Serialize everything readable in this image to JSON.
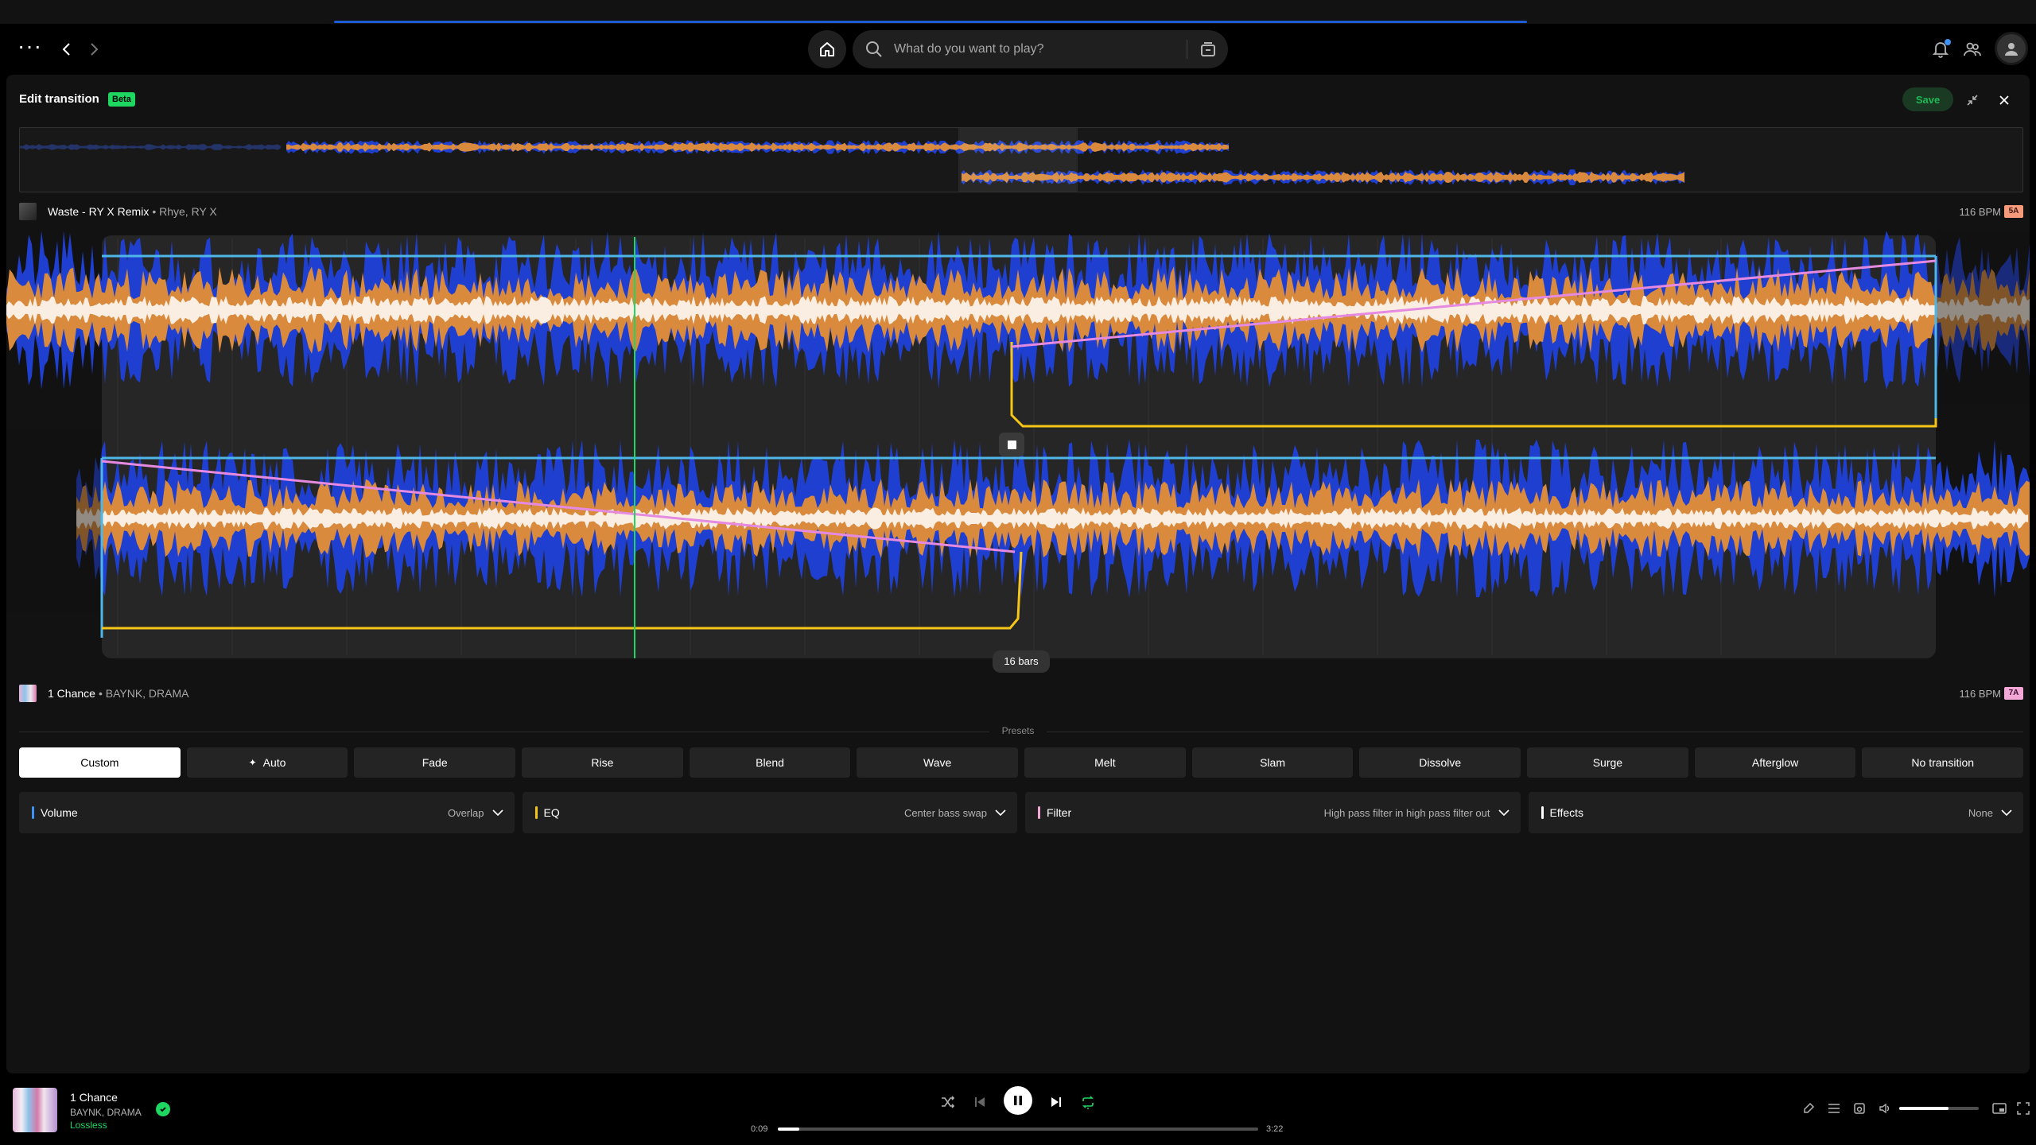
{
  "search": {
    "placeholder": "What do you want to play?"
  },
  "editor": {
    "title": "Edit transition",
    "badge": "Beta",
    "save_label": "Save",
    "bars_label": "16 bars",
    "presets_label": "Presets"
  },
  "track_a": {
    "name": "Waste - RY X Remix",
    "artist": "• Rhye, RY X",
    "bpm": "116 BPM",
    "key": "5A",
    "key_color": "#f59b7c"
  },
  "track_b": {
    "name": "1 Chance",
    "artist": "• BAYNK, DRAMA",
    "bpm": "116 BPM",
    "key": "7A",
    "key_color": "#f2a7d6"
  },
  "presets": [
    {
      "label": "Custom",
      "active": true
    },
    {
      "label": "Auto",
      "icon": "sparkle-icon"
    },
    {
      "label": "Fade"
    },
    {
      "label": "Rise"
    },
    {
      "label": "Blend"
    },
    {
      "label": "Wave"
    },
    {
      "label": "Melt"
    },
    {
      "label": "Slam"
    },
    {
      "label": "Dissolve"
    },
    {
      "label": "Surge"
    },
    {
      "label": "Afterglow"
    },
    {
      "label": "No transition"
    }
  ],
  "controls": [
    {
      "label": "Volume",
      "value": "Overlap",
      "color": "#3d91f4"
    },
    {
      "label": "EQ",
      "value": "Center bass swap",
      "color": "#f5c518"
    },
    {
      "label": "Filter",
      "value": "High pass filter in high pass filter out",
      "color": "#f2a7d6"
    },
    {
      "label": "Effects",
      "value": "None",
      "color": "#ffffff"
    }
  ],
  "player": {
    "title": "1 Chance",
    "artist": "BAYNK, DRAMA",
    "quality": "Lossless",
    "elapsed": "0:09",
    "duration": "3:22",
    "progress": 0.045,
    "volume": 0.62
  },
  "colors": {
    "accent": "#1ed760",
    "wave_blue": "#1f3fd0",
    "wave_orange": "#d98a3c",
    "cue_blue": "#4fb6e8",
    "volume_pink": "#e58ae0",
    "eq_yellow": "#f5c518",
    "playhead": "#1ed760"
  }
}
